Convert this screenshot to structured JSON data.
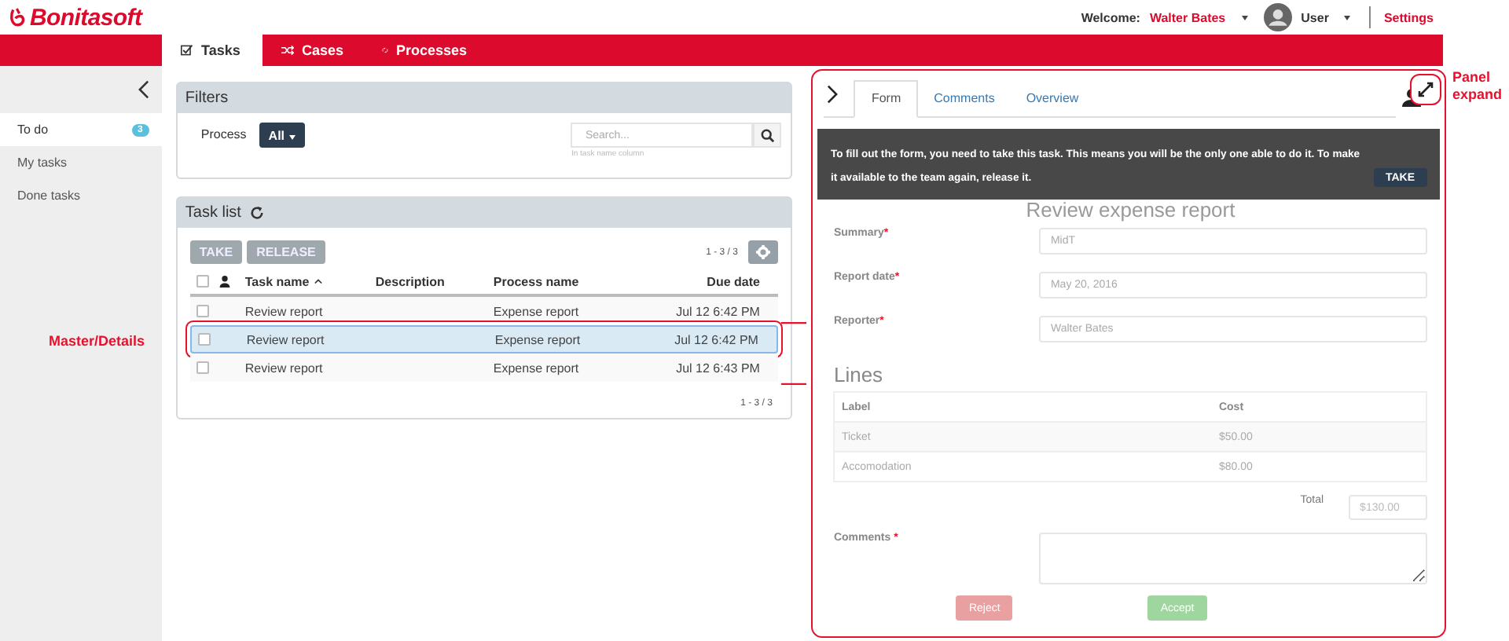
{
  "header": {
    "logo": "Bonitasoft",
    "welcome": "Welcome:",
    "user_name": "Walter Bates",
    "profile": "User",
    "settings": "Settings"
  },
  "nav_tabs": [
    {
      "label": "Tasks",
      "selected": true
    },
    {
      "label": "Cases",
      "selected": false
    },
    {
      "label": "Processes",
      "selected": false
    }
  ],
  "sidebar": {
    "items": [
      {
        "label": "To do",
        "badge": "3",
        "selected": true
      },
      {
        "label": "My tasks",
        "selected": false
      },
      {
        "label": "Done tasks",
        "selected": false
      }
    ]
  },
  "filters": {
    "title": "Filters",
    "process_label": "Process",
    "process_value": "All",
    "search": {
      "placeholder": "Search...",
      "hint": "In task name column"
    }
  },
  "task_list": {
    "title": "Task list",
    "take": "TAKE",
    "release": "RELEASE",
    "range_top": "1 - 3 / 3",
    "range_bottom": "1 - 3 / 3",
    "select_all_checked": false,
    "columns": [
      "Task name",
      "Description",
      "Process name",
      "Due date"
    ],
    "rows": [
      {
        "task": "Review report",
        "description": "",
        "process": "Expense report",
        "due": "Jul 12 6:42 PM",
        "selected": false,
        "checked": false
      },
      {
        "task": "Review report",
        "description": "",
        "process": "Expense report",
        "due": "Jul 12 6:42 PM",
        "selected": true,
        "checked": false
      },
      {
        "task": "Review report",
        "description": "",
        "process": "Expense report",
        "due": "Jul 12 6:43 PM",
        "selected": false,
        "checked": false
      }
    ]
  },
  "detail": {
    "tabs": [
      {
        "label": "Form",
        "selected": true
      },
      {
        "label": "Comments",
        "selected": false
      },
      {
        "label": "Overview",
        "selected": false
      }
    ],
    "banner": "To fill out the form, you need to take this task. This means you will be the only one able to do it. To make it available to the team again, release it.",
    "banner_button": "TAKE",
    "form_title": "Review expense report",
    "fields": [
      {
        "label": "Summary",
        "required": "*",
        "value": "MidT"
      },
      {
        "label": "Report date",
        "required": "*",
        "value": "May 20, 2016"
      },
      {
        "label": "Reporter",
        "required": "*",
        "value": "Walter Bates"
      }
    ],
    "lines_title": "Lines",
    "lines_columns": [
      "Label",
      "Cost"
    ],
    "lines": [
      [
        "Ticket",
        "$50.00"
      ],
      [
        "Accomodation",
        "$80.00"
      ]
    ],
    "total_label": "Total",
    "total_value": "$130.00",
    "comments_label": "Comments ",
    "comments_required": "*",
    "buttons": [
      {
        "label": "Reject",
        "kind": "danger"
      },
      {
        "label": "Accept",
        "kind": "success"
      }
    ]
  },
  "annotations": {
    "master_details": "Master/Details",
    "panel_expand": "Panel expand"
  }
}
